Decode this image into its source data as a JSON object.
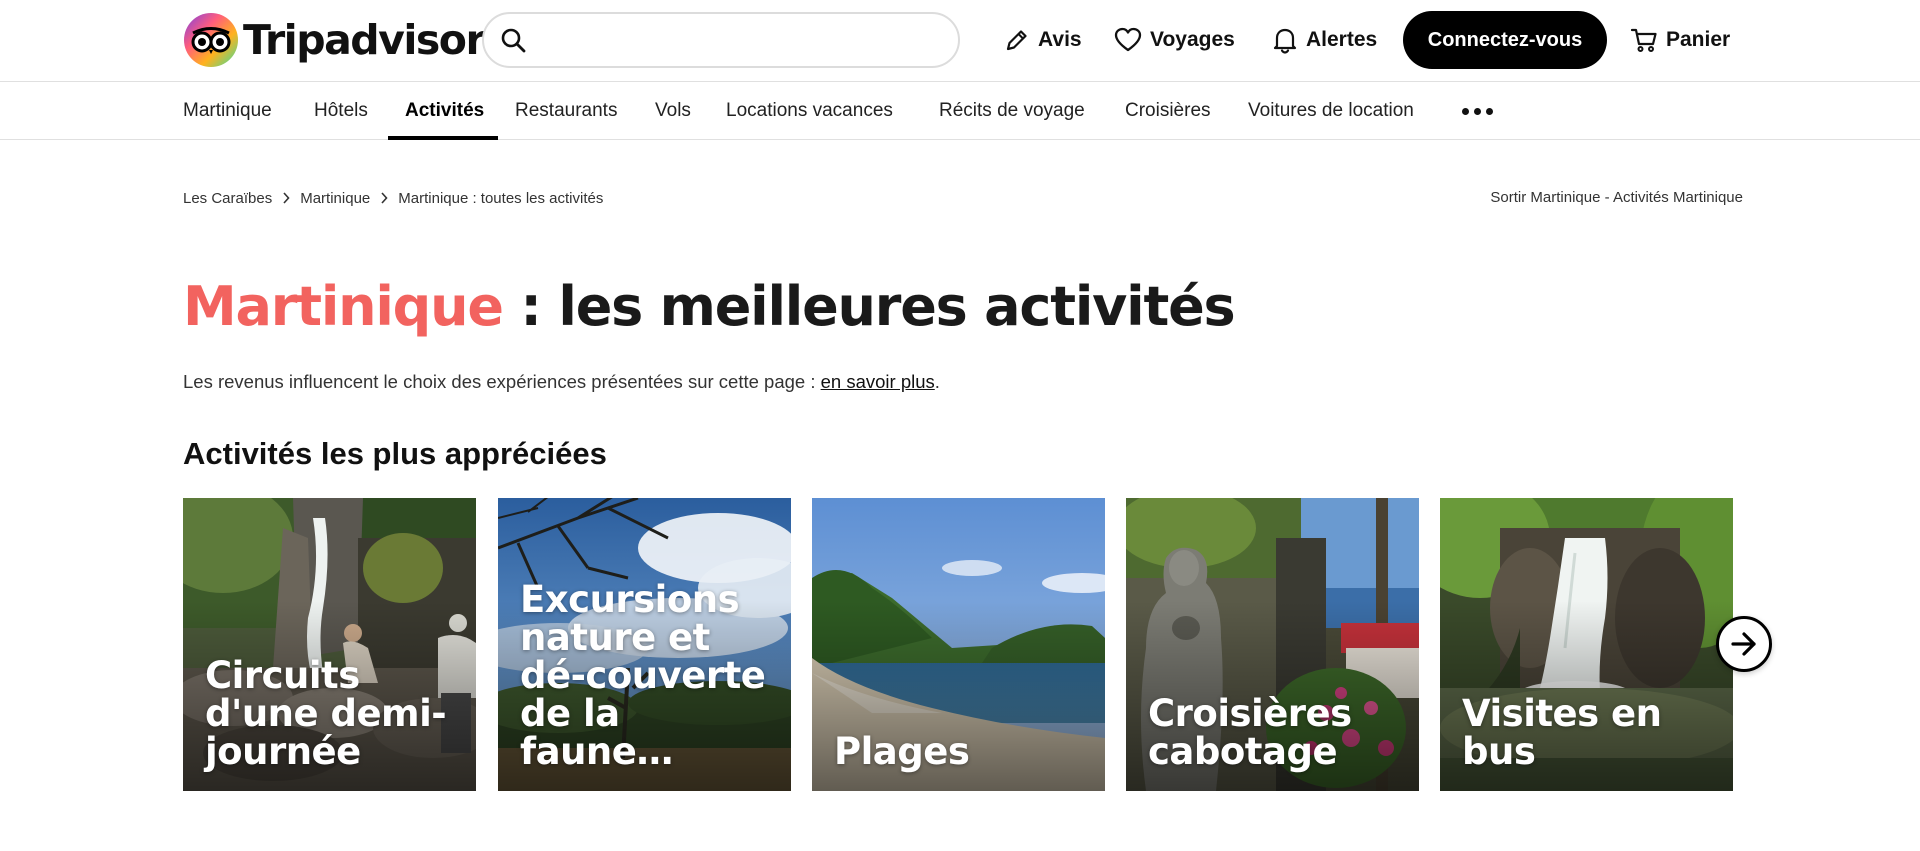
{
  "brand": {
    "name": "Tripadvisor",
    "colors": {
      "accent": "#f2635f",
      "black": "#000000",
      "owl_green": "#34e0a1"
    }
  },
  "header": {
    "search_value": "",
    "links": {
      "reviews": "Avis",
      "trips": "Voyages",
      "alerts": "Alertes",
      "cart": "Panier"
    },
    "login_label": "Connectez-vous",
    "icons": [
      "search-icon",
      "pencil-icon",
      "heart-icon",
      "bell-icon",
      "cart-icon"
    ]
  },
  "tabs": {
    "items": [
      {
        "label": "Martinique"
      },
      {
        "label": "Hôtels"
      },
      {
        "label": "Activités",
        "active": true
      },
      {
        "label": "Restaurants"
      },
      {
        "label": "Vols"
      },
      {
        "label": "Locations vacances"
      },
      {
        "label": "Récits de voyage"
      },
      {
        "label": "Croisières"
      },
      {
        "label": "Voitures de location"
      }
    ],
    "more_icon": "more-dots-icon"
  },
  "breadcrumb": {
    "items": [
      "Les Caraïbes",
      "Martinique",
      "Martinique : toutes les activités"
    ],
    "exit_link": "Sortir Martinique - Activités Martinique"
  },
  "title": {
    "place": "Martinique",
    "rest": " : les meilleures activités"
  },
  "disclaimer": {
    "text": "Les revenus influencent le choix des expériences présentées sur cette page : ",
    "link": "en savoir plus",
    "end": "."
  },
  "section": {
    "title": "Activités les plus appréciées",
    "cards": [
      {
        "label": "Circuits d'une demi-journée"
      },
      {
        "label": "Excursions nature et dé-couverte de la faune…"
      },
      {
        "label": "Plages"
      },
      {
        "label": "Croisières cabotage"
      },
      {
        "label": "Visites en bus"
      }
    ],
    "next_icon": "arrow-right-icon"
  }
}
